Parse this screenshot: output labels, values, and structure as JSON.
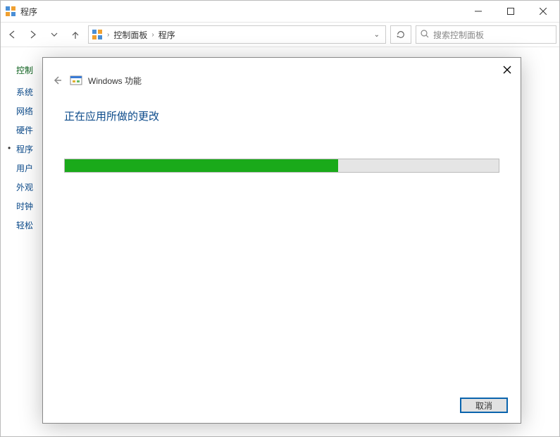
{
  "window": {
    "title": "程序"
  },
  "breadcrumb": {
    "items": [
      "控制面板",
      "程序"
    ]
  },
  "search": {
    "placeholder": "搜索控制面板"
  },
  "sidebar": {
    "heading": "控制",
    "items": [
      {
        "label": "系统",
        "active": false
      },
      {
        "label": "网络",
        "active": false
      },
      {
        "label": "硬件",
        "active": false
      },
      {
        "label": "程序",
        "active": true
      },
      {
        "label": "用户",
        "active": false
      },
      {
        "label": "外观",
        "active": false
      },
      {
        "label": "时钟",
        "active": false
      },
      {
        "label": "轻松",
        "active": false
      }
    ]
  },
  "dialog": {
    "title": "Windows 功能",
    "status": "正在应用所做的更改",
    "progress_percent": 63,
    "cancel_label": "取消"
  }
}
